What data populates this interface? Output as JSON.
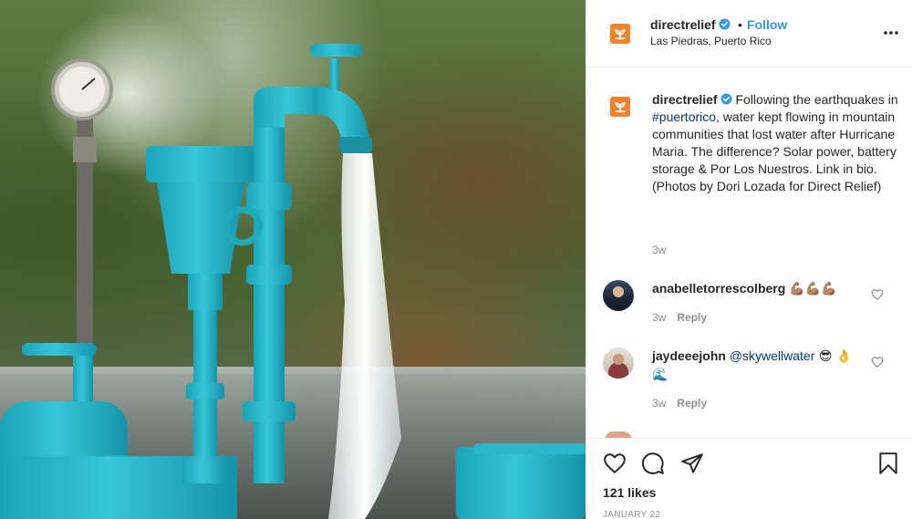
{
  "post": {
    "username": "directrelief",
    "follow_label": "Follow",
    "separator": "•",
    "location": "Las Piedras, Puerto Rico"
  },
  "caption": {
    "username": "directrelief",
    "text_before_tag": "Following the earthquakes in ",
    "hashtag": "#puertorico",
    "text_after_tag": ", water kept flowing in mountain communities that lost water after Hurricane Maria. The difference? Solar power, battery storage & Por Los Nuestros. Link in bio. (Photos by Dori Lozada for Direct Relief)",
    "time": "3w"
  },
  "comments": [
    {
      "username": "anabelletorrescolberg",
      "text": "💪🏽💪🏽💪🏽",
      "time": "3w",
      "reply_label": "Reply"
    },
    {
      "username": "jaydeeejohn",
      "mention": "@skywellwater",
      "text": " 😎 👌🌊",
      "time": "3w",
      "reply_label": "Reply"
    }
  ],
  "footer": {
    "likes": "121 likes",
    "date": "JANUARY 22"
  },
  "colors": {
    "brand_orange": "#f0832a",
    "link_blue": "#3897f0",
    "verified_blue": "#3897f0",
    "muted": "#8e8e8e"
  },
  "icons": {
    "like": "heart-icon",
    "comment": "comment-bubble-icon",
    "share": "paper-plane-icon",
    "save": "bookmark-icon",
    "more": "ellipsis-icon",
    "verified": "verified-badge-icon"
  }
}
